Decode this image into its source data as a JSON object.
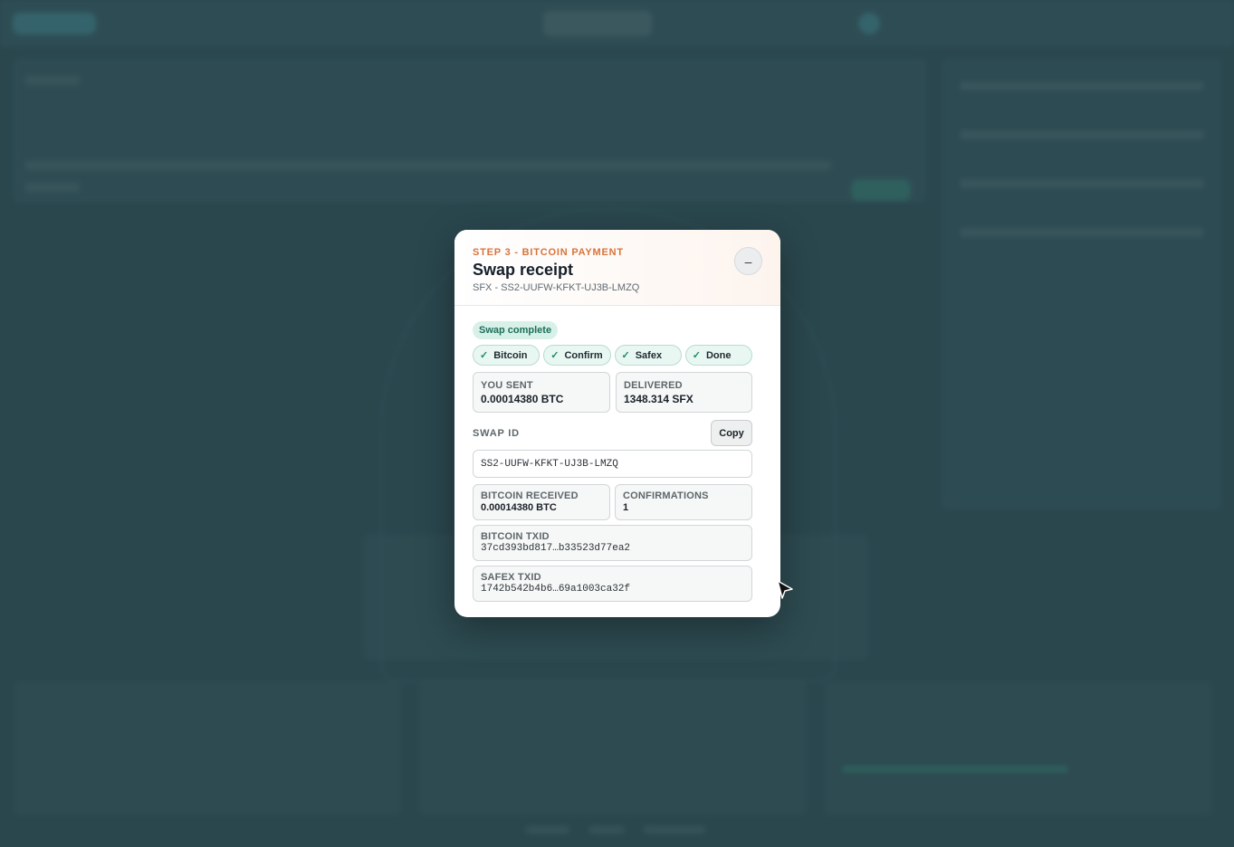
{
  "modal": {
    "step_label": "STEP 3 - BITCOIN PAYMENT",
    "title": "Swap receipt",
    "subtitle": "SFX - SS2-UUFW-KFKT-UJ3B-LMZQ",
    "minimize_symbol": "–",
    "status_badge": "Swap complete",
    "steps": [
      {
        "label": "Bitcoin",
        "check": "✓"
      },
      {
        "label": "Confirm",
        "check": "✓"
      },
      {
        "label": "Safex",
        "check": "✓"
      },
      {
        "label": "Done",
        "check": "✓"
      }
    ],
    "you_sent": {
      "label": "YOU SENT",
      "value": "0.00014380 BTC"
    },
    "delivered": {
      "label": "DELIVERED",
      "value": "1348.314 SFX"
    },
    "swap_id": {
      "label": "SWAP ID",
      "copy_label": "Copy",
      "value": "SS2-UUFW-KFKT-UJ3B-LMZQ"
    },
    "bitcoin_received": {
      "label": "BITCOIN RECEIVED",
      "value": "0.00014380 BTC"
    },
    "confirmations": {
      "label": "CONFIRMATIONS",
      "value": "1"
    },
    "bitcoin_txid": {
      "label": "BITCOIN TXID",
      "value": "37cd393bd817…b33523d77ea2"
    },
    "safex_txid": {
      "label": "SAFEX TXID",
      "value": "1742b542b4b6…69a1003ca32f"
    }
  },
  "colors": {
    "accent_orange": "#d8733a",
    "success_green": "#1f8a6a",
    "backdrop": "#2f4a52"
  },
  "icons": {
    "minimize": "minimize-icon",
    "check": "check-icon",
    "cursor": "mouse-pointer-icon"
  }
}
